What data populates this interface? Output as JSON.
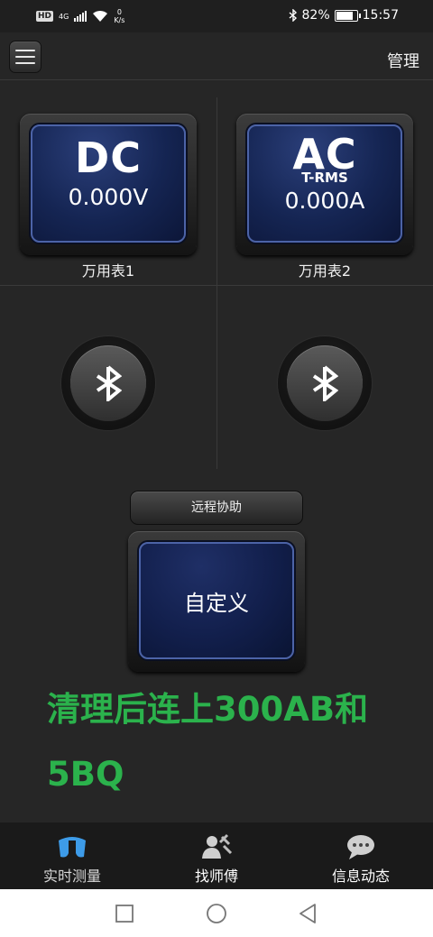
{
  "status_bar": {
    "hd": "HD",
    "network": "4G",
    "speed_value": "0",
    "speed_unit": "K/s",
    "battery": "82%",
    "time": "15:57"
  },
  "header": {
    "menu_icon": "hamburger-menu-icon",
    "manage_label": "管理"
  },
  "meters": [
    {
      "mode": "DC",
      "sub": "",
      "value": "0.000V",
      "label": "万用表1"
    },
    {
      "mode": "AC",
      "sub": "T-RMS",
      "value": "0.000A",
      "label": "万用表2"
    }
  ],
  "bluetooth": {
    "icon": "bluetooth-icon"
  },
  "remote_assist_label": "远程协助",
  "custom_label": "自定义",
  "note": {
    "line1": "清理后连上300AB和",
    "line2": "5BQ",
    "color": "#2bb24c"
  },
  "bottom_nav": [
    {
      "label": "实时测量",
      "icon": "multimeter-icon",
      "active": true
    },
    {
      "label": "找师傅",
      "icon": "technician-icon",
      "active": false
    },
    {
      "label": "信息动态",
      "icon": "chat-bubble-icon",
      "active": false
    }
  ],
  "system_nav": {
    "icons": [
      "recent-apps-icon",
      "home-icon",
      "back-icon"
    ]
  }
}
